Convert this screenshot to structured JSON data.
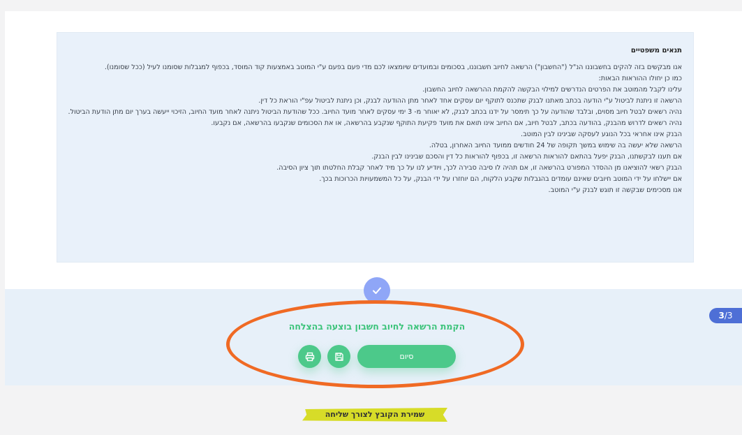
{
  "legal": {
    "title": "תנאים משפטיים",
    "lines": [
      "אנו מבקשים בזה להקים בחשבוננו הנ\"ל (\"החשבון\") הרשאה לחיוב חשבוננו, בסכומים ובמועדים שיומצאו לכם מדי פעם בפעם ע\"י המוטב באמצעות קוד המוסד, בכפוף למגבלות שסומנו לעיל (ככל שסומנו).",
      "כמו כן יחולו ההוראות הבאות:",
      "עלינו לקבל מהמוטב את הפרטים הנדרשים למילוי הבקשה להקמת ההרשאה לחיוב החשבון.",
      "הרשאה זו ניתנת לביטול ע\"י הודעה בכתב מאתנו לבנק שתכנס לתוקף יום עסקים אחד לאחר מתן ההודעה לבנק, וכן ניתנת לביטול עפ\"י הוראת כל דין.",
      "נהיה רשאים לבטל חיוב מסוים, ובלבד שהודעה על כך תימסר על ידנו בכתב לבנק, לא יאוחר מ- 3 ימי עסקים לאחר מועד החיוב. ככל שהודעת הביטול ניתנה לאחר מועד החיוב, הזיכוי ייעשה בערך יום מתן הודעת הביטול.",
      "נהיה רשאים לדרוש מהבנק, בהודעה בכתב, לבטל חיוב, אם החיוב אינו תואם את מועד פקיעת התוקף שנקבע בהרשאה, או את הסכומים שנקבעו בהרשאה, אם נקבעו.",
      "הבנק אינו אחראי בכל הנוגע לעסקה שבינינו לבין המוטב.",
      "הרשאה שלא יעשה בה שימוש במשך תקופה של 24 חודשים ממועד החיוב האחרון, בטלה.",
      "אם תענו לבקשתנו, הבנק יפעל בהתאם להוראות הרשאה זו, בכפוף להוראות כל דין והסכם שבינינו לבין הבנק.",
      "הבנק רשאי להוציאנו מן ההסדר המפורט בהרשאה זו, אם תהיה לו סיבה סבירה לכך, ויודיע לנו על כך מיד לאחר קבלת החלטתו תוך ציון הסיבה.",
      "אם יישלחו על ידי המוטב חיובים שאינם עומדים בהגבלות שקבע הלקוח, הם יוחזרו על ידי הבנק, על כל המשמעויות הכרוכות בכך.",
      "אנו מסכימים שבקשה זו תוגש לבנק ע\"י המוטב."
    ]
  },
  "step": {
    "current": "3",
    "total": "/3"
  },
  "success_message": "הקמת הרשאה לחיוב חשבון בוצעה בהצלחה",
  "buttons": {
    "finish": "סיום"
  },
  "icons": {
    "check": "check-icon",
    "save": "save-icon",
    "print": "print-icon"
  },
  "annotation": {
    "caption": "שמירת הקובץ לצורך שליחה"
  },
  "colors": {
    "accent_green": "#4cc98a",
    "step_badge": "#4e6fd6",
    "highlight_ellipse": "#f06a24",
    "highlight_marker": "#d7dc28"
  }
}
